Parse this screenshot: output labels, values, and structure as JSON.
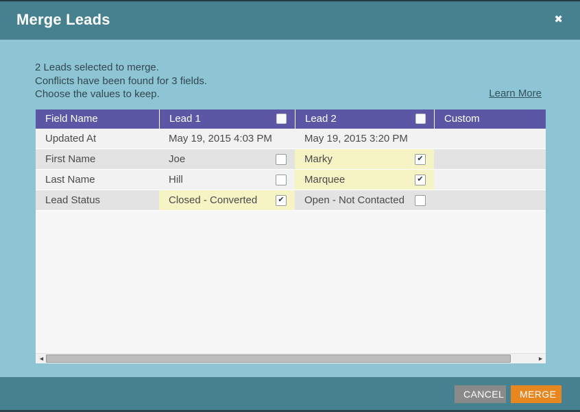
{
  "colors": {
    "titlebar_teal": "#47818f",
    "body_light_blue": "#8ec5d4",
    "table_header_purple": "#5b57a5",
    "selected_cell_yellow": "#f6f3c4",
    "row_light_gray": "#f2f2f2",
    "row_dark_gray": "#e3e3e3",
    "merge_button_orange": "#e8861f",
    "cancel_button_gray": "#8a8a8a"
  },
  "icons": {
    "close": "✖",
    "check": "✔",
    "scroll_left": "◄",
    "scroll_right": "►"
  },
  "header": {
    "title": "Merge Leads"
  },
  "summary": {
    "lines": [
      "2 Leads selected to merge.",
      "Conflicts have been found for 3 fields.",
      "Choose the values to keep."
    ],
    "learn_more_label": "Learn More"
  },
  "table": {
    "columns": {
      "field_name": "Field Name",
      "lead1": "Lead 1",
      "lead2": "Lead 2",
      "custom": "Custom"
    },
    "header_checkboxes": {
      "lead1_checked": false,
      "lead2_checked": false
    },
    "rows": [
      {
        "field": "Updated At",
        "lead1": {
          "value": "May 19, 2015 4:03 PM",
          "has_checkbox": false,
          "checked": false,
          "selected": false
        },
        "lead2": {
          "value": "May 19, 2015 3:20 PM",
          "has_checkbox": false,
          "checked": false,
          "selected": false
        },
        "custom": ""
      },
      {
        "field": "First Name",
        "lead1": {
          "value": "Joe",
          "has_checkbox": true,
          "checked": false,
          "selected": false
        },
        "lead2": {
          "value": "Marky",
          "has_checkbox": true,
          "checked": true,
          "selected": true
        },
        "custom": ""
      },
      {
        "field": "Last Name",
        "lead1": {
          "value": "Hill",
          "has_checkbox": true,
          "checked": false,
          "selected": false
        },
        "lead2": {
          "value": "Marquee",
          "has_checkbox": true,
          "checked": true,
          "selected": true
        },
        "custom": ""
      },
      {
        "field": "Lead Status",
        "lead1": {
          "value": "Closed - Converted",
          "has_checkbox": true,
          "checked": true,
          "selected": true
        },
        "lead2": {
          "value": "Open - Not Contacted",
          "has_checkbox": true,
          "checked": false,
          "selected": false
        },
        "custom": ""
      }
    ]
  },
  "footer": {
    "cancel_label": "CANCEL",
    "merge_label": "MERGE"
  }
}
